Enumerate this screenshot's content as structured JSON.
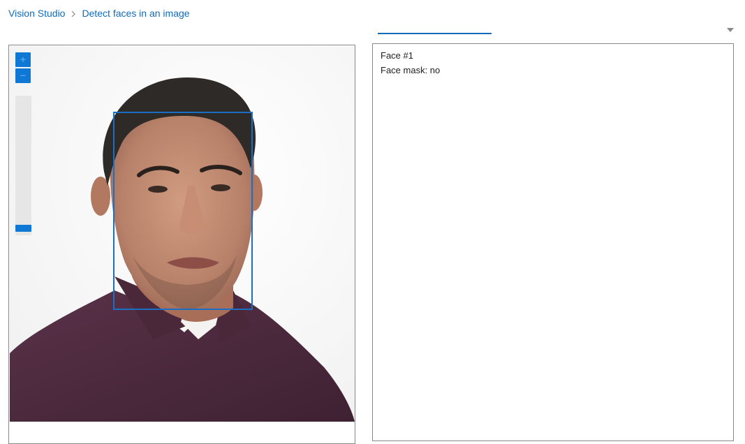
{
  "breadcrumb": {
    "items": [
      {
        "label": "Vision Studio"
      },
      {
        "label": "Detect faces in an image"
      }
    ]
  },
  "image_viewer": {
    "zoom": {
      "in_icon": "plus-icon",
      "out_icon": "minus-icon",
      "level": 0
    },
    "detections": [
      {
        "label": "Face #1"
      }
    ]
  },
  "results": {
    "lines": [
      "Face #1",
      "Face mask: no"
    ]
  },
  "colors": {
    "accent": "#0f6cbd",
    "bounding_box": "#1a6fc4",
    "shirt": "#4e2a3f",
    "hair": "#2e2a28"
  }
}
